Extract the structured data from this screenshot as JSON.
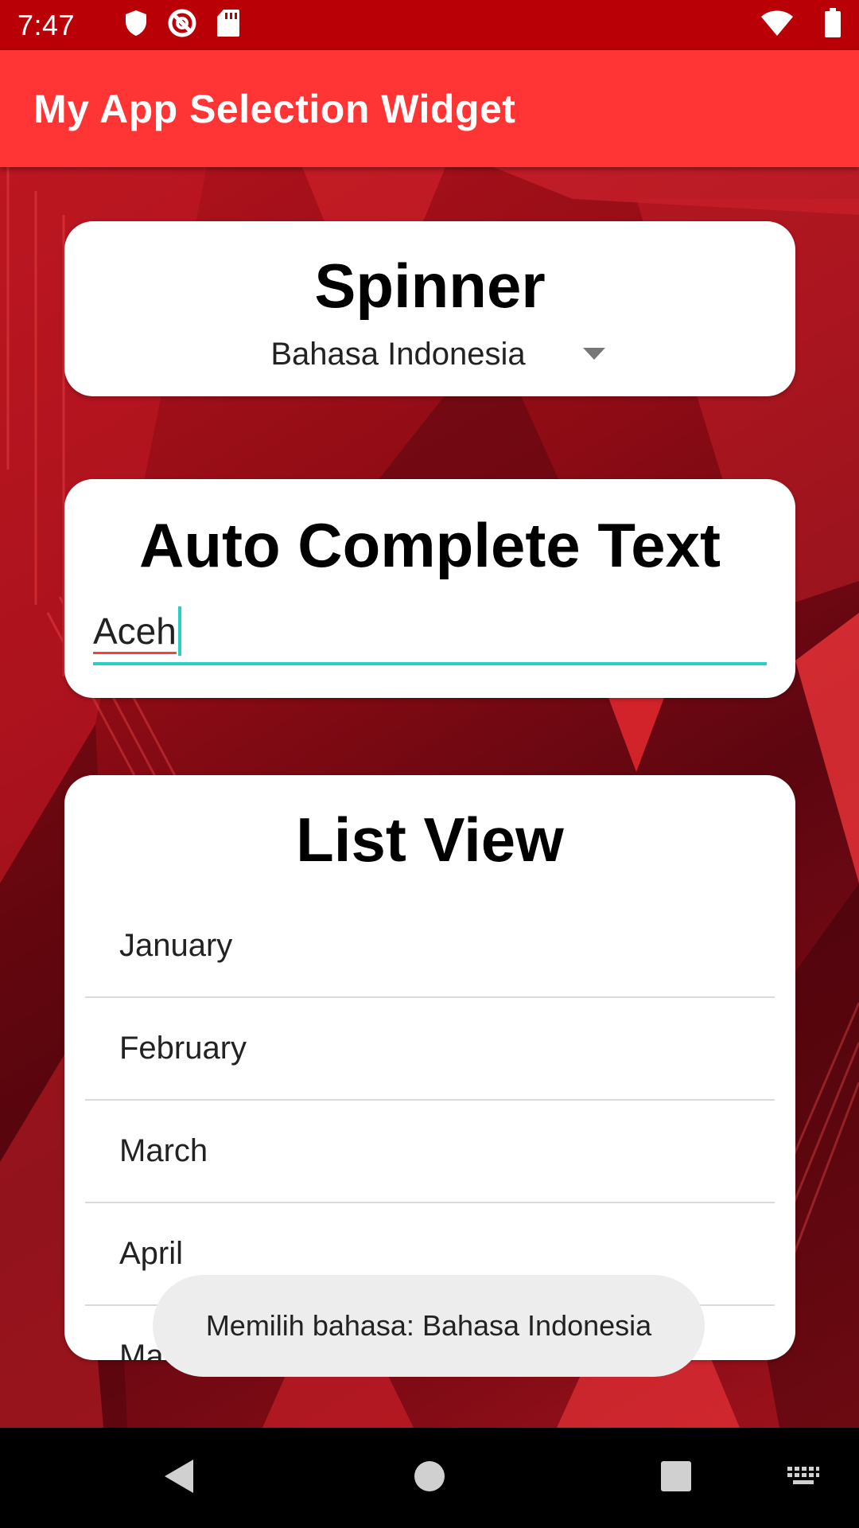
{
  "status_bar": {
    "time": "7:47",
    "left_icons": [
      "shield-icon",
      "no-sync-icon",
      "sd-card-icon"
    ],
    "right_icons": [
      "wifi-icon",
      "battery-icon"
    ],
    "background_color": "#b80006"
  },
  "app_bar": {
    "title": "My App Selection Widget",
    "background_color": "#ff3535"
  },
  "spinner_section": {
    "title": "Spinner",
    "selected_value": "Bahasa Indonesia"
  },
  "autocomplete_section": {
    "title": "Auto Complete Text",
    "input_value": "Aceh",
    "accent_color": "#27cfc6"
  },
  "list_section": {
    "title": "List View",
    "items": [
      "January",
      "February",
      "March",
      "April",
      "May"
    ]
  },
  "toast": {
    "message": "Memilih bahasa: Bahasa Indonesia"
  },
  "nav_bar": {
    "buttons": [
      "back-icon",
      "home-icon",
      "recents-icon",
      "keyboard-icon"
    ]
  }
}
